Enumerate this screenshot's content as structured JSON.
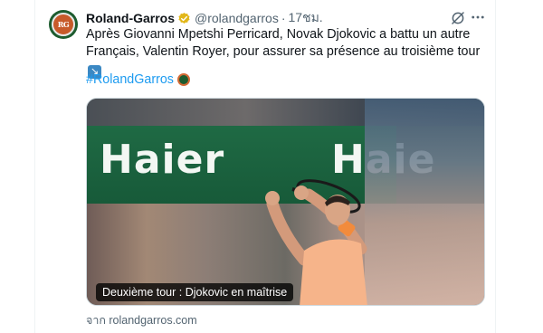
{
  "tweet": {
    "author_name": "Roland-Garros",
    "handle": "@rolandgarros",
    "separator": "·",
    "time": "17ชม.",
    "text": "Après Giovanni Mpetshi Perricard, Novak Djokovic a battu un autre Français, Valentin Royer, pour assurer sa présence au troisième tour",
    "hashtag": "#RolandGarros",
    "avatar_text": "RG"
  },
  "media": {
    "board_left": "Haier",
    "board_right": "Haie",
    "caption": "Deuxième tour : Djokovic en maîtrise"
  },
  "card_source": "จาก rolandgarros.com",
  "icons": {
    "verified": "verified-badge-icon",
    "grok": "grok-icon",
    "more": "more-options-icon",
    "arrow": "down-right-arrow-emoji"
  },
  "colors": {
    "link": "#1d9bf0",
    "secondary_text": "#536471",
    "verified": "#e2b719"
  }
}
